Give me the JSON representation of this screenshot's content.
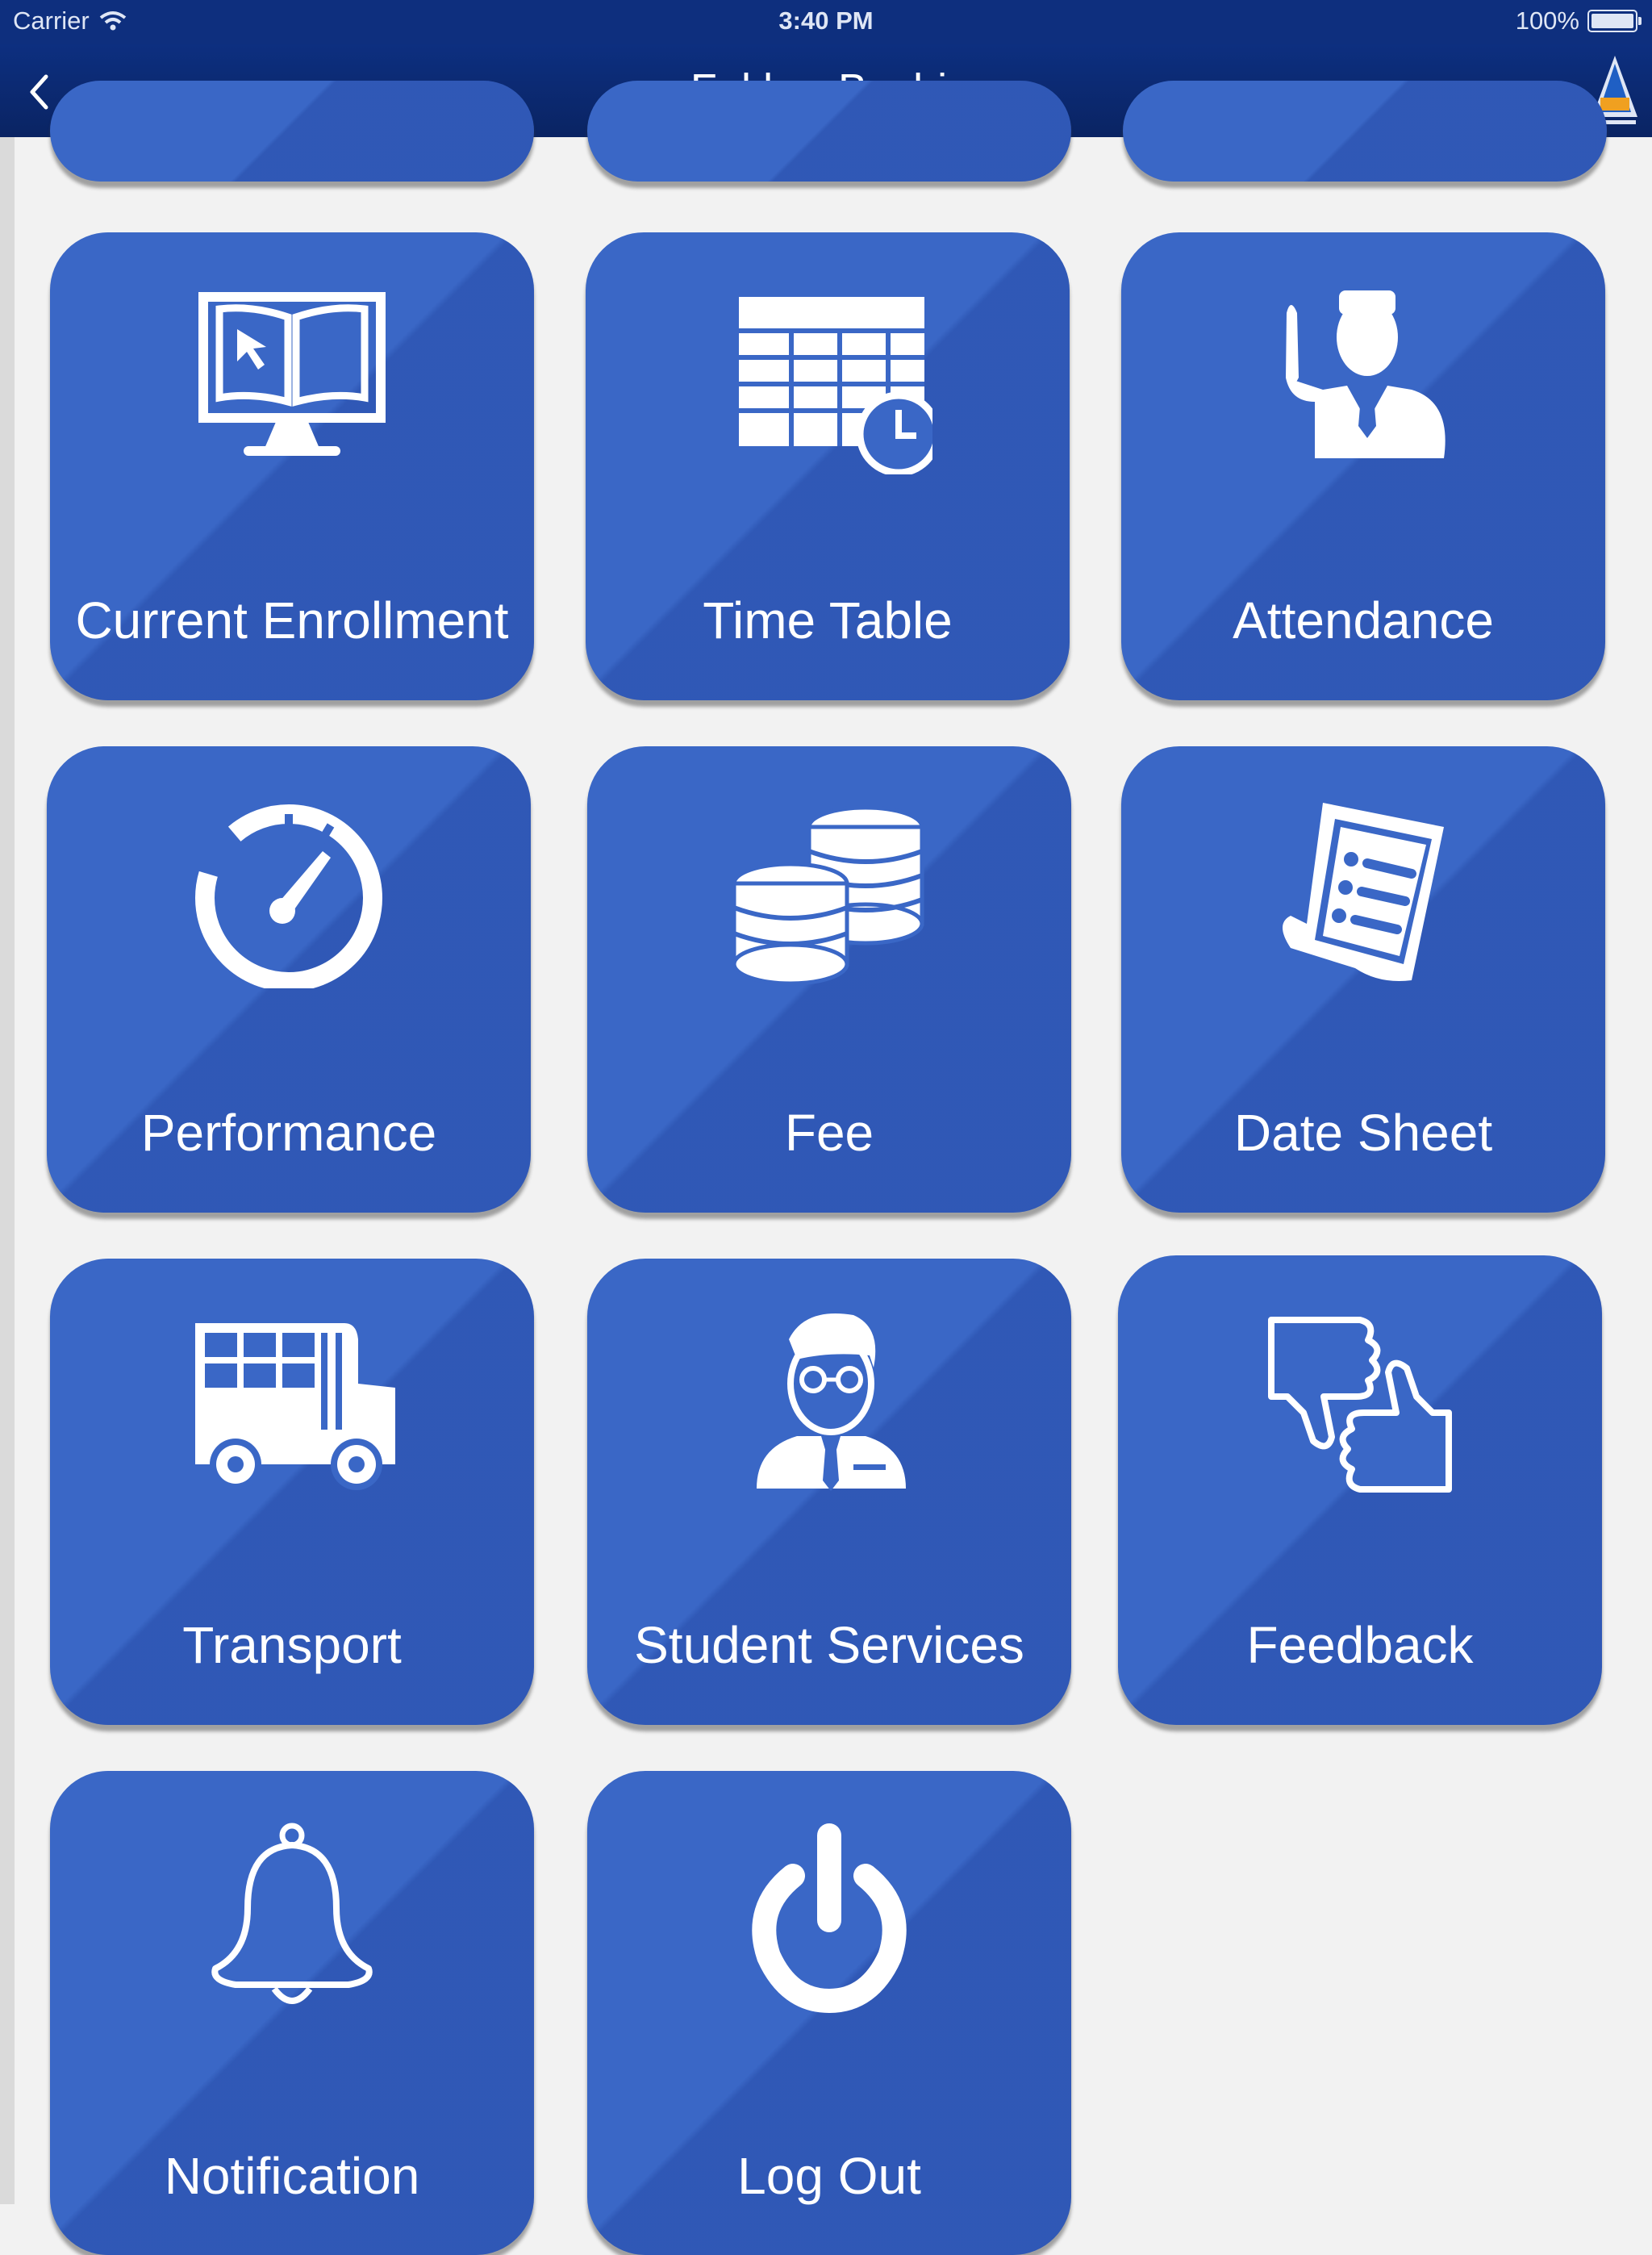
{
  "status_bar": {
    "carrier": "Carrier",
    "time": "3:40 PM",
    "battery": "100%"
  },
  "nav": {
    "title": "Fakhar Bashir"
  },
  "menu": {
    "items": [
      {
        "label": "Current Enrollment",
        "icon": "monitor-book-icon"
      },
      {
        "label": "Time Table",
        "icon": "timetable-clock-icon"
      },
      {
        "label": "Attendance",
        "icon": "raised-hand-person-icon"
      },
      {
        "label": "Performance",
        "icon": "speedometer-icon"
      },
      {
        "label": "Fee",
        "icon": "coins-stack-icon"
      },
      {
        "label": "Date Sheet",
        "icon": "document-list-icon"
      },
      {
        "label": "Transport",
        "icon": "bus-icon"
      },
      {
        "label": "Student Services",
        "icon": "person-glasses-icon"
      },
      {
        "label": "Feedback",
        "icon": "thumbs-up-down-icon"
      },
      {
        "label": "Notification",
        "icon": "bell-icon"
      },
      {
        "label": "Log Out",
        "icon": "power-icon"
      }
    ]
  },
  "colors": {
    "tile": "#3a67c6",
    "nav": "#0d2f80",
    "background": "#f2f2f2"
  }
}
